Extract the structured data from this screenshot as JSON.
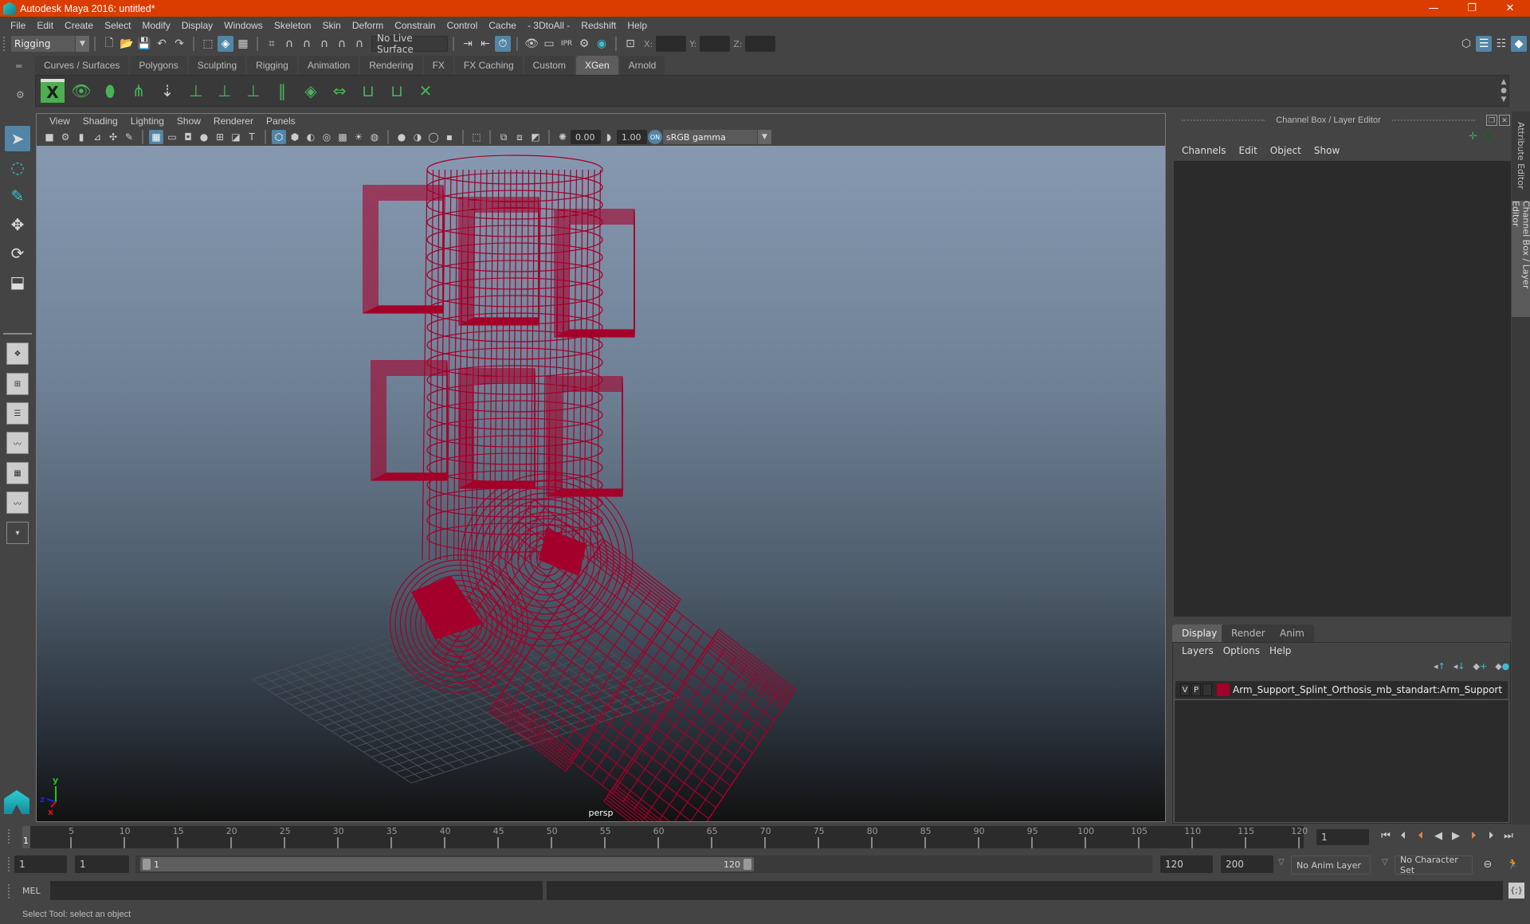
{
  "window": {
    "title": "Autodesk Maya 2016: untitled*",
    "controls": {
      "minimize": "—",
      "restore": "❐",
      "close": "✕"
    }
  },
  "menubar": [
    "File",
    "Edit",
    "Create",
    "Select",
    "Modify",
    "Display",
    "Windows",
    "Skeleton",
    "Skin",
    "Deform",
    "Constrain",
    "Control",
    "Cache",
    "- 3DtoAll -",
    "Redshift",
    "Help"
  ],
  "statusline": {
    "menuset": "Rigging",
    "live_surface": "No Live Surface",
    "coords": {
      "x_label": "X:",
      "y_label": "Y:",
      "z_label": "Z:",
      "x": "",
      "y": "",
      "z": ""
    }
  },
  "shelf": {
    "tabs": [
      "Curves / Surfaces",
      "Polygons",
      "Sculpting",
      "Rigging",
      "Animation",
      "Rendering",
      "FX",
      "FX Caching",
      "Custom",
      "XGen",
      "Arnold"
    ],
    "active_tab": "XGen",
    "icons": [
      "xgen-editor-icon",
      "xgen-preview-icon",
      "xgen-clear-preview-icon",
      "xgen-add-guides-icon",
      "xgen-place-icon",
      "xgen-add-modifier-icon",
      "xgen-show-guide-icon",
      "xgen-lock-icon",
      "xgen-bend-icon",
      "xgen-region-map-icon",
      "xgen-rebuild-icon",
      "xgen-select-guides-icon",
      "xgen-guide-shape-icon",
      "xgen-delete-guides-icon"
    ]
  },
  "viewport": {
    "menu": [
      "View",
      "Shading",
      "Lighting",
      "Show",
      "Renderer",
      "Panels"
    ],
    "exposure": "0.00",
    "gamma": "1.00",
    "color_space": "sRGB gamma",
    "camera_label": "persp",
    "wire_color": "#a3002b",
    "axis": {
      "x": "x",
      "y": "y",
      "z": "z"
    }
  },
  "channel_box": {
    "title": "Channel Box / Layer Editor",
    "menu": [
      "Channels",
      "Edit",
      "Object",
      "Show"
    ]
  },
  "side_tabs": [
    "Attribute Editor",
    "Channel Box / Layer Editor"
  ],
  "layer_editor": {
    "tabs": [
      "Display",
      "Render",
      "Anim"
    ],
    "active_tab": "Display",
    "menu": [
      "Layers",
      "Options",
      "Help"
    ],
    "layers": [
      {
        "visible": "V",
        "playback": "P",
        "color": "#a3002b",
        "name": "Arm_Support_Splint_Orthosis_mb_standart:Arm_Support"
      }
    ]
  },
  "timeline": {
    "ticks": [
      "5",
      "10",
      "15",
      "20",
      "25",
      "30",
      "35",
      "40",
      "45",
      "50",
      "55",
      "60",
      "65",
      "70",
      "75",
      "80",
      "85",
      "90",
      "95",
      "100",
      "105",
      "110",
      "115",
      "120"
    ],
    "current_frame_marker": "1",
    "current_frame": "1",
    "range_min": 1,
    "range_max": 120
  },
  "range_slider": {
    "start_field": "1",
    "playback_start": "1",
    "slider_start": "1",
    "slider_end": "120",
    "playback_end": "120",
    "end_field": "200",
    "anim_layer": "No Anim Layer",
    "character_set": "No Character Set"
  },
  "command_line": {
    "label": "MEL",
    "input": "",
    "result": ""
  },
  "help_line": "Select Tool: select an object"
}
